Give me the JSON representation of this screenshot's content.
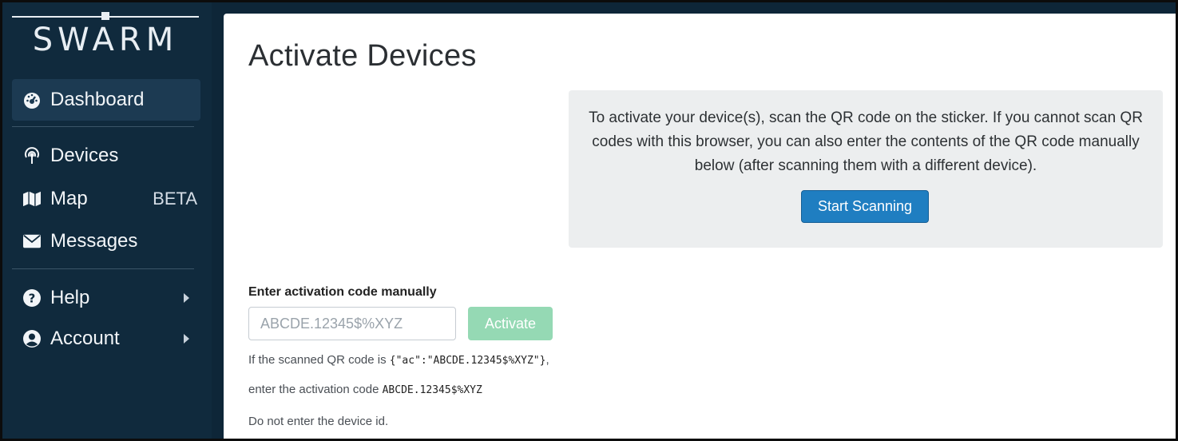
{
  "app": {
    "logo_text": "SWARM"
  },
  "sidebar": {
    "items": [
      {
        "label": "Dashboard",
        "icon": "dashboard-gauge-icon",
        "active": true
      },
      {
        "label": "Devices",
        "icon": "antenna-icon"
      },
      {
        "label": "Map",
        "icon": "map-icon",
        "badge": "BETA"
      },
      {
        "label": "Messages",
        "icon": "envelope-icon"
      },
      {
        "label": "Help",
        "icon": "question-circle-icon",
        "has_submenu": true
      },
      {
        "label": "Account",
        "icon": "user-circle-icon",
        "has_submenu": true
      }
    ]
  },
  "main": {
    "title": "Activate Devices",
    "info": {
      "text": "To activate your device(s), scan the QR code on the sticker. If you cannot scan QR codes with this browser, you can also enter the contents of the QR code manually below (after scanning them with a different device).",
      "button_label": "Start Scanning"
    },
    "manual": {
      "label": "Enter activation code manually",
      "placeholder": "ABCDE.12345$%XYZ",
      "value": "",
      "button_label": "Activate",
      "help_line1_prefix": "If the scanned QR code is ",
      "help_line1_code": "{\"ac\":\"ABCDE.12345$%XYZ\"}",
      "help_line1_suffix": ",",
      "help_line2_prefix": "enter the activation code ",
      "help_line2_code": "ABCDE.12345$%XYZ",
      "help_line3": "Do not enter the device id."
    }
  },
  "colors": {
    "sidebar_bg": "#102a3d",
    "sidebar_active": "#1c3a52",
    "primary_button": "#1f7ec1",
    "activate_disabled": "#95d9b4",
    "info_box_bg": "#eceeef"
  }
}
